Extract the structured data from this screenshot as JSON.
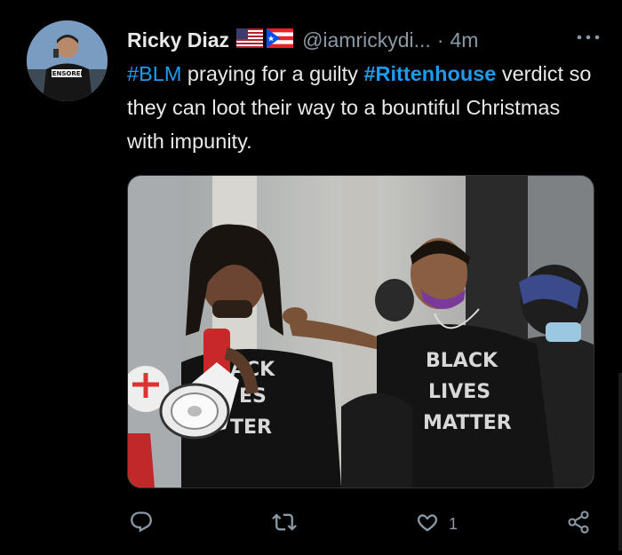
{
  "tweet": {
    "author_name": "Ricky Diaz",
    "handle": "@iamrickydi...",
    "separator": "·",
    "time": "4m",
    "text_segments": [
      {
        "text": "#BLM",
        "type": "hashtag"
      },
      {
        "text": " praying for a guilty ",
        "type": "plain"
      },
      {
        "text": "#Rittenhouse",
        "type": "hashtag-bold"
      },
      {
        "text": " verdict so they can loot their way to a bountiful Christmas with impunity.",
        "type": "plain"
      }
    ],
    "avatar_text": "CENSORED",
    "image_shirt_text": "BLACK LIVES MATTER",
    "image_shirt_text_left": "ACK ES TER"
  },
  "actions": {
    "reply_count": "",
    "retweet_count": "",
    "like_count": "1"
  },
  "icons": [
    "us-flag-icon",
    "puerto-rico-flag-icon",
    "more-icon",
    "reply-icon",
    "retweet-icon",
    "like-icon",
    "share-icon"
  ],
  "colors": {
    "background": "#000000",
    "text": "#e7e9ea",
    "muted": "#8b98a5",
    "link": "#1d9bf0"
  }
}
